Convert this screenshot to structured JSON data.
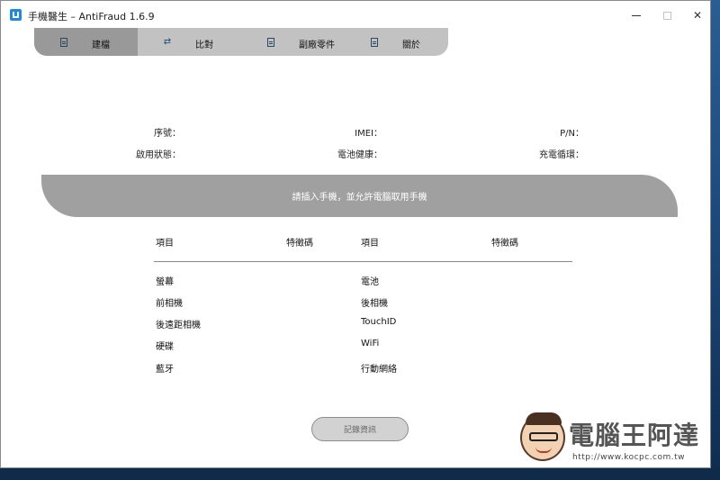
{
  "window": {
    "title": "手機醫生 – AntiFraud 1.6.9",
    "minimize": "—",
    "maximize": "□",
    "close": "✕"
  },
  "tabs": [
    {
      "label": "建檔",
      "icon": "document-icon",
      "active": true
    },
    {
      "label": "比對",
      "icon": "swap-arrows-icon",
      "active": false
    },
    {
      "label": "副廠零件",
      "icon": "document-icon",
      "active": false
    },
    {
      "label": "關於",
      "icon": "document-icon",
      "active": false
    }
  ],
  "device_info": {
    "serial_label": "序號：",
    "imei_label": "IMEI：",
    "pn_label": "P/N：",
    "activation_label": "啟用狀態：",
    "battery_health_label": "電池健康：",
    "charge_cycles_label": "充電循環："
  },
  "banner": {
    "message": "請插入手機，並允許電腦取用手機"
  },
  "table": {
    "headers": [
      "項目",
      "特徵碼",
      "項目",
      "特徵碼"
    ],
    "left_items": [
      "螢幕",
      "前相機",
      "後遠距相機",
      "硬碟",
      "藍牙"
    ],
    "right_items": [
      "電池",
      "後相機",
      "TouchID",
      "WiFi",
      "行動網絡"
    ]
  },
  "record_button": "記錄資訊",
  "watermark": {
    "brand": "電腦王阿達",
    "url": "http://www.kocpc.com.tw"
  }
}
